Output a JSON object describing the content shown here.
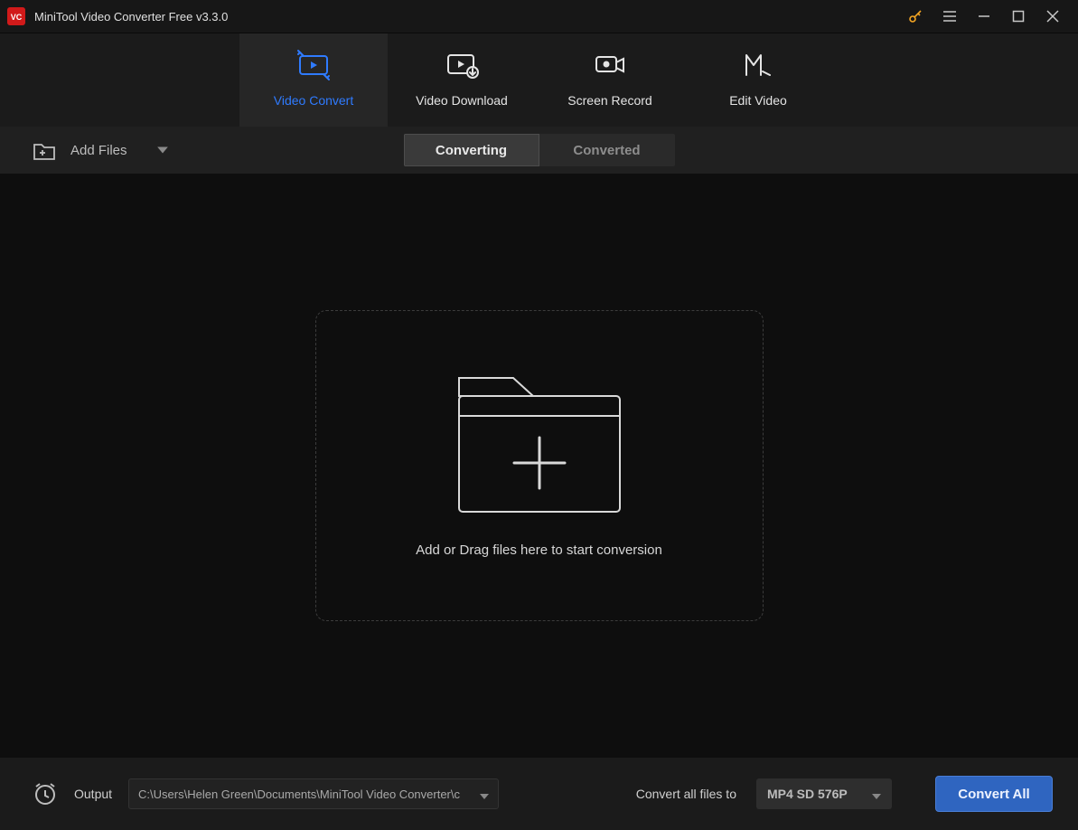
{
  "titlebar": {
    "app_title": "MiniTool Video Converter Free v3.3.0",
    "logo_text": "VC"
  },
  "main_tabs": [
    {
      "id": "video-convert",
      "label": "Video Convert",
      "active": true
    },
    {
      "id": "video-download",
      "label": "Video Download",
      "active": false
    },
    {
      "id": "screen-record",
      "label": "Screen Record",
      "active": false
    },
    {
      "id": "edit-video",
      "label": "Edit Video",
      "active": false
    }
  ],
  "toolbar": {
    "add_files_label": "Add Files"
  },
  "sub_tabs": [
    {
      "id": "converting",
      "label": "Converting",
      "active": true
    },
    {
      "id": "converted",
      "label": "Converted",
      "active": false
    }
  ],
  "dropzone": {
    "text": "Add or Drag files here to start conversion"
  },
  "bottom": {
    "output_label": "Output",
    "output_path": "C:\\Users\\Helen Green\\Documents\\MiniTool Video Converter\\c",
    "convert_to_label": "Convert all files to",
    "format_selected": "MP4 SD 576P",
    "convert_all_label": "Convert All"
  },
  "colors": {
    "accent": "#2f7bff",
    "primary_button": "#2f65c0"
  }
}
